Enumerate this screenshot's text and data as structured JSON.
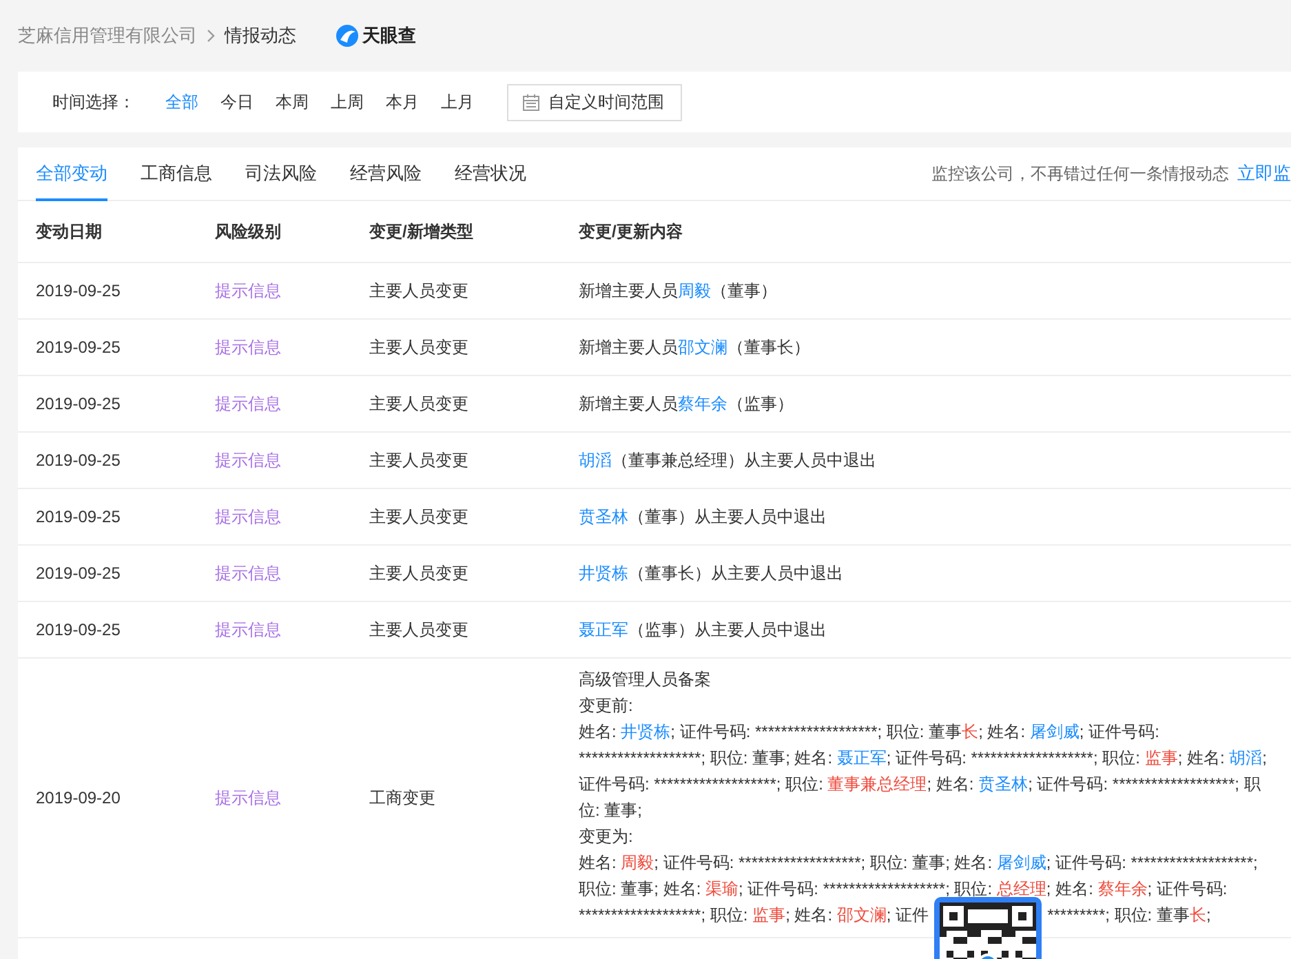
{
  "breadcrumb": {
    "items": [
      {
        "label": "芝麻信用管理有限公司"
      },
      {
        "label": "情报动态"
      }
    ],
    "logo": "天眼查"
  },
  "time_filter": {
    "label": "时间选择：",
    "options": [
      {
        "label": "全部",
        "selected": true
      },
      {
        "label": "今日",
        "selected": false
      },
      {
        "label": "本周",
        "selected": false
      },
      {
        "label": "上周",
        "selected": false
      },
      {
        "label": "本月",
        "selected": false
      },
      {
        "label": "上月",
        "selected": false
      }
    ],
    "custom_button": "自定义时间范围"
  },
  "tabs": [
    {
      "label": "全部变动",
      "selected": true
    },
    {
      "label": "工商信息",
      "selected": false
    },
    {
      "label": "司法风险",
      "selected": false
    },
    {
      "label": "经营风险",
      "selected": false
    },
    {
      "label": "经营状况",
      "selected": false
    }
  ],
  "monitor": {
    "text": "监控该公司，不再错过任何一条情报动态",
    "link": "立即监"
  },
  "table": {
    "columns": [
      "变动日期",
      "风险级别",
      "变更/新增类型",
      "变更/更新内容"
    ],
    "rows": [
      {
        "date": "2019-09-25",
        "risk": "提示信息",
        "type": "主要人员变更",
        "content": [
          [
            {
              "kind": "text",
              "text": "新增主要人员"
            },
            {
              "kind": "link",
              "text": "周毅"
            },
            {
              "kind": "text",
              "text": "（董事）"
            }
          ]
        ]
      },
      {
        "date": "2019-09-25",
        "risk": "提示信息",
        "type": "主要人员变更",
        "content": [
          [
            {
              "kind": "text",
              "text": "新增主要人员"
            },
            {
              "kind": "link",
              "text": "邵文澜"
            },
            {
              "kind": "text",
              "text": "（董事长）"
            }
          ]
        ]
      },
      {
        "date": "2019-09-25",
        "risk": "提示信息",
        "type": "主要人员变更",
        "content": [
          [
            {
              "kind": "text",
              "text": "新增主要人员"
            },
            {
              "kind": "link",
              "text": "蔡年余"
            },
            {
              "kind": "text",
              "text": "（监事）"
            }
          ]
        ]
      },
      {
        "date": "2019-09-25",
        "risk": "提示信息",
        "type": "主要人员变更",
        "content": [
          [
            {
              "kind": "link",
              "text": "胡滔"
            },
            {
              "kind": "text",
              "text": "（董事兼总经理）从主要人员中退出"
            }
          ]
        ]
      },
      {
        "date": "2019-09-25",
        "risk": "提示信息",
        "type": "主要人员变更",
        "content": [
          [
            {
              "kind": "link",
              "text": "贲圣林"
            },
            {
              "kind": "text",
              "text": "（董事）从主要人员中退出"
            }
          ]
        ]
      },
      {
        "date": "2019-09-25",
        "risk": "提示信息",
        "type": "主要人员变更",
        "content": [
          [
            {
              "kind": "link",
              "text": "井贤栋"
            },
            {
              "kind": "text",
              "text": "（董事长）从主要人员中退出"
            }
          ]
        ]
      },
      {
        "date": "2019-09-25",
        "risk": "提示信息",
        "type": "主要人员变更",
        "content": [
          [
            {
              "kind": "link",
              "text": "聂正军"
            },
            {
              "kind": "text",
              "text": "（监事）从主要人员中退出"
            }
          ]
        ]
      },
      {
        "date": "2019-09-20",
        "risk": "提示信息",
        "type": "工商变更",
        "content": [
          [
            {
              "kind": "text",
              "text": "高级管理人员备案"
            }
          ],
          [
            {
              "kind": "text",
              "text": "变更前:"
            }
          ],
          [
            {
              "kind": "text",
              "text": "姓名: "
            },
            {
              "kind": "link",
              "text": "井贤栋"
            },
            {
              "kind": "text",
              "text": "; 证件号码: *******************; 职位: 董事"
            },
            {
              "kind": "changed",
              "text": "长"
            },
            {
              "kind": "text",
              "text": "; 姓名: "
            },
            {
              "kind": "link",
              "text": "屠剑威"
            },
            {
              "kind": "text",
              "text": "; 证件号码: *******************; 职位: 董事; 姓名: "
            },
            {
              "kind": "link",
              "text": "聂正军"
            },
            {
              "kind": "text",
              "text": "; 证件号码: *******************; 职位: "
            },
            {
              "kind": "changed",
              "text": "监事"
            },
            {
              "kind": "text",
              "text": "; 姓名: "
            },
            {
              "kind": "link",
              "text": "胡滔"
            },
            {
              "kind": "text",
              "text": "; 证件号码: *******************; 职位: "
            },
            {
              "kind": "changed",
              "text": "董事兼总经理"
            },
            {
              "kind": "text",
              "text": "; 姓名: "
            },
            {
              "kind": "link",
              "text": "贲圣林"
            },
            {
              "kind": "text",
              "text": "; 证件号码: *******************; 职位: 董事;"
            }
          ],
          [
            {
              "kind": "text",
              "text": "变更为:"
            }
          ],
          [
            {
              "kind": "text",
              "text": "姓名: "
            },
            {
              "kind": "changed_link",
              "text": "周毅"
            },
            {
              "kind": "text",
              "text": "; 证件号码: *******************; 职位: 董事; 姓名: "
            },
            {
              "kind": "link",
              "text": "屠剑威"
            },
            {
              "kind": "text",
              "text": "; 证件号码: *******************; 职位: 董事; 姓名: "
            },
            {
              "kind": "changed_link",
              "text": "渠瑜"
            },
            {
              "kind": "text",
              "text": "; 证件号码: *******************; 职位: "
            },
            {
              "kind": "changed",
              "text": "总经理"
            },
            {
              "kind": "text",
              "text": "; 姓名: "
            },
            {
              "kind": "changed_link",
              "text": "蔡年余"
            },
            {
              "kind": "text",
              "text": "; 证件号码: *******************; 职位: "
            },
            {
              "kind": "changed",
              "text": "监事"
            },
            {
              "kind": "text",
              "text": "; 姓名: "
            },
            {
              "kind": "changed_link",
              "text": "邵文澜"
            },
            {
              "kind": "text",
              "text": "; 证件"
            },
            {
              "kind": "qr"
            },
            {
              "kind": "text",
              "text": "*********;"
            },
            {
              "kind": "text",
              "text": " 职位: 董事"
            },
            {
              "kind": "changed",
              "text": "长"
            },
            {
              "kind": "text",
              "text": ";"
            }
          ]
        ]
      }
    ]
  }
}
